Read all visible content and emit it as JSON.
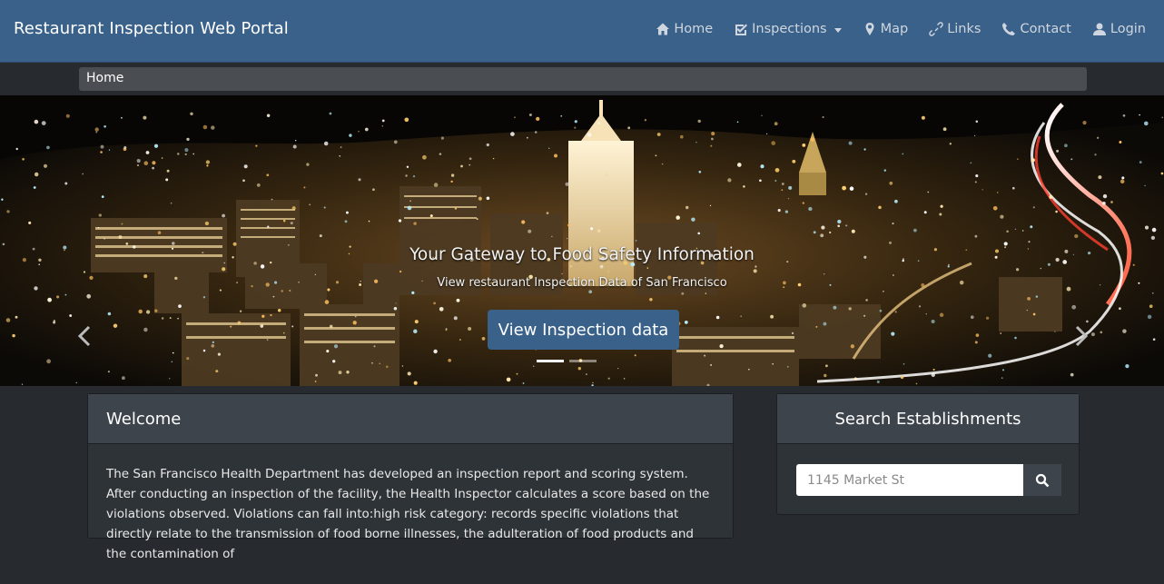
{
  "brand": "Restaurant Inspection Web Portal",
  "nav": [
    {
      "label": "Home",
      "icon": "home-icon"
    },
    {
      "label": "Inspections",
      "icon": "checkbox-icon"
    },
    {
      "label": "Map",
      "icon": "map-marker-icon"
    },
    {
      "label": "Links",
      "icon": "link-icon"
    },
    {
      "label": "Contact",
      "icon": "phone-icon"
    },
    {
      "label": "Login",
      "icon": "user-icon"
    }
  ],
  "breadcrumb": "Home",
  "carousel": {
    "title": "Your Gateway to Food Safety Information",
    "subtitle": "View restaurant Inspection Data of San Francisco",
    "button": "View Inspection data",
    "slides": 2,
    "active_slide": 1
  },
  "welcome": {
    "heading": "Welcome",
    "text": "The San Francisco Health Department has developed an inspection report and scoring system. After conducting an inspection of the facility, the Health Inspector calculates a score based on the violations observed. Violations can fall into:high risk category: records specific violations that directly relate to the transmission of food borne illnesses, the adulteration of food products and the contamination of"
  },
  "search": {
    "heading": "Search Establishments",
    "placeholder": "1145 Market St"
  },
  "colors": {
    "navbar": "#3a6189",
    "background": "#272b30",
    "panel": "#2e3338",
    "panel_heading": "#3e444c",
    "button": "#3a6189"
  }
}
